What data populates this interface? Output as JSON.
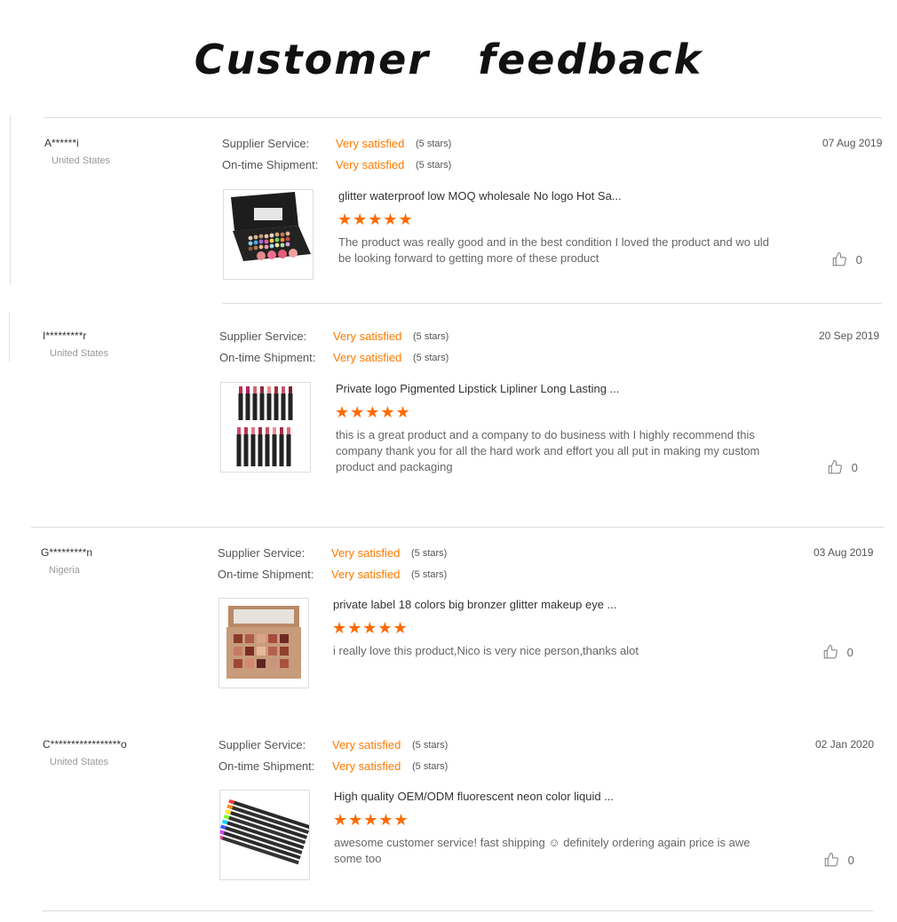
{
  "page": {
    "title": "Customer   feedback"
  },
  "colors": {
    "accent": "#ff7a00",
    "star": "#ff6a00",
    "separator": "#dcdcdc"
  },
  "reviews": [
    {
      "reviewer": "A******i",
      "country": "United States",
      "date": "07 Aug 2019",
      "ratings": [
        {
          "label": "Supplier Service:",
          "value": "Very satisfied",
          "stars_note": "(5 stars)"
        },
        {
          "label": "On-time Shipment:",
          "value": "Very satisfied",
          "stars_note": "(5 stars)"
        }
      ],
      "product_title": "glitter waterproof low MOQ wholesale No logo Hot Sa...",
      "product_rating": 5,
      "text": "The product was really good and in the best condition I loved the product and wo uld be looking forward to getting more of these product",
      "likes": "0"
    },
    {
      "reviewer": "I*********r",
      "country": "United States",
      "date": "20 Sep 2019",
      "ratings": [
        {
          "label": "Supplier Service:",
          "value": "Very satisfied",
          "stars_note": "(5 stars)"
        },
        {
          "label": "On-time Shipment:",
          "value": "Very satisfied",
          "stars_note": "(5 stars)"
        }
      ],
      "product_title": "Private logo Pigmented Lipstick Lipliner Long Lasting ...",
      "product_rating": 5,
      "text": "this is a great  product  and a company  to do business  with  I highly recommend this company  thank you for all the hard work and effort you all put in making my custom  product  and packaging",
      "likes": "0"
    },
    {
      "reviewer": "G*********n",
      "country": "Nigeria",
      "date": "03 Aug 2019",
      "ratings": [
        {
          "label": "Supplier Service:",
          "value": "Very satisfied",
          "stars_note": "(5 stars)"
        },
        {
          "label": "On-time Shipment:",
          "value": "Very satisfied",
          "stars_note": "(5 stars)"
        }
      ],
      "product_title": "private label 18 colors big bronzer glitter makeup eye ...",
      "product_rating": 5,
      "text": "i really love this product,Nico is very nice person,thanks alot",
      "likes": "0"
    },
    {
      "reviewer": "C*****************o",
      "country": "United States",
      "date": "02 Jan 2020",
      "ratings": [
        {
          "label": "Supplier Service:",
          "value": "Very satisfied",
          "stars_note": "(5 stars)"
        },
        {
          "label": "On-time Shipment:",
          "value": "Very satisfied",
          "stars_note": "(5 stars)"
        }
      ],
      "product_title": "High quality OEM/ODM fluorescent neon color liquid ...",
      "product_rating": 5,
      "text": "awesome customer service! fast shipping ☺ definitely ordering again price is awe some too",
      "likes": "0"
    }
  ]
}
